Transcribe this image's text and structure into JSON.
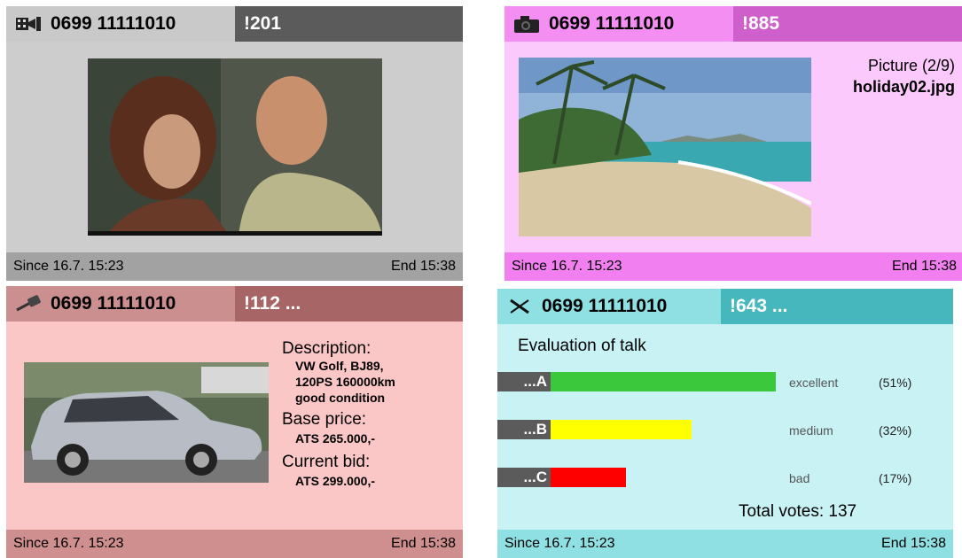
{
  "panels": [
    {
      "phone": "0699 11111010",
      "code": "!201",
      "icon": "film-icon",
      "since": "Since 16.7. 15:23",
      "end": "End 15:38"
    },
    {
      "phone": "0699 11111010",
      "code": "!885",
      "icon": "camera-icon",
      "since": "Since 16.7. 15:23",
      "end": "End 15:38",
      "picture_index": "Picture (2/9)",
      "filename": "holiday02.jpg"
    },
    {
      "phone": "0699 11111010",
      "code": "!112 ...",
      "icon": "gavel-icon",
      "since": "Since 16.7. 15:23",
      "end": "End 15:38",
      "description_label": "Description:",
      "description_lines": [
        "VW Golf, BJ89,",
        "120PS 160000km",
        "good condition"
      ],
      "base_price_label": "Base price:",
      "base_price": "ATS 265.000,-",
      "current_bid_label": "Current bid:",
      "current_bid": "ATS 299.000,-"
    },
    {
      "phone": "0699 11111010",
      "code": "!643 ...",
      "icon": "vote-cross-icon",
      "since": "Since 16.7. 15:23",
      "end": "End 15:38",
      "title": "Evaluation of talk",
      "options": [
        {
          "tag": "...A",
          "label": "excellent",
          "pct_text": "(51%)",
          "pct": 51,
          "color": "#3cc83c"
        },
        {
          "tag": "...B",
          "label": "medium",
          "pct_text": "(32%)",
          "pct": 32,
          "color": "#ffff00"
        },
        {
          "tag": "...C",
          "label": "bad",
          "pct_text": "(17%)",
          "pct": 17,
          "color": "#ff0000"
        }
      ],
      "total": "Total votes: 137"
    }
  ]
}
